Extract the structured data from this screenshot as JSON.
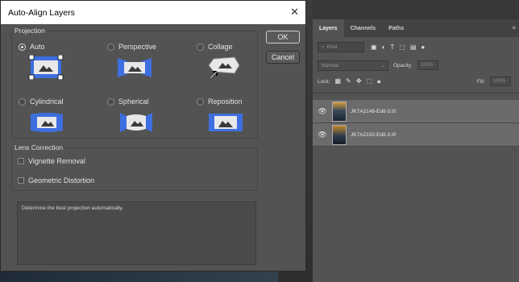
{
  "dialog": {
    "title": "Auto-Align Layers",
    "projection_legend": "Projection",
    "options": [
      {
        "label": "Auto",
        "selected": true
      },
      {
        "label": "Perspective",
        "selected": false
      },
      {
        "label": "Collage",
        "selected": false
      },
      {
        "label": "Cylindrical",
        "selected": false
      },
      {
        "label": "Spherical",
        "selected": false
      },
      {
        "label": "Reposition",
        "selected": false
      }
    ],
    "ok_label": "OK",
    "cancel_label": "Cancel",
    "lens_legend": "Lens Correction",
    "vignette_label": "Vignette Removal",
    "geometric_label": "Geometric Distortion",
    "description": "Determine the best projection automatically."
  },
  "panel": {
    "tabs": [
      "Layers",
      "Channels",
      "Paths"
    ],
    "kind_label": "Kind",
    "blend_mode": "Normal",
    "opacity_label": "Opacity:",
    "opacity_value": "100%",
    "lock_label": "Lock:",
    "fill_label": "Fill:",
    "fill_value": "100%",
    "layers": [
      {
        "name": "JK7A2148-Edit-3.tif"
      },
      {
        "name": "JK7A2150-Edit-3.tif"
      }
    ]
  },
  "colors": {
    "accent_blue": "#3d6fe0",
    "icon_gray": "#d0d0d0"
  }
}
